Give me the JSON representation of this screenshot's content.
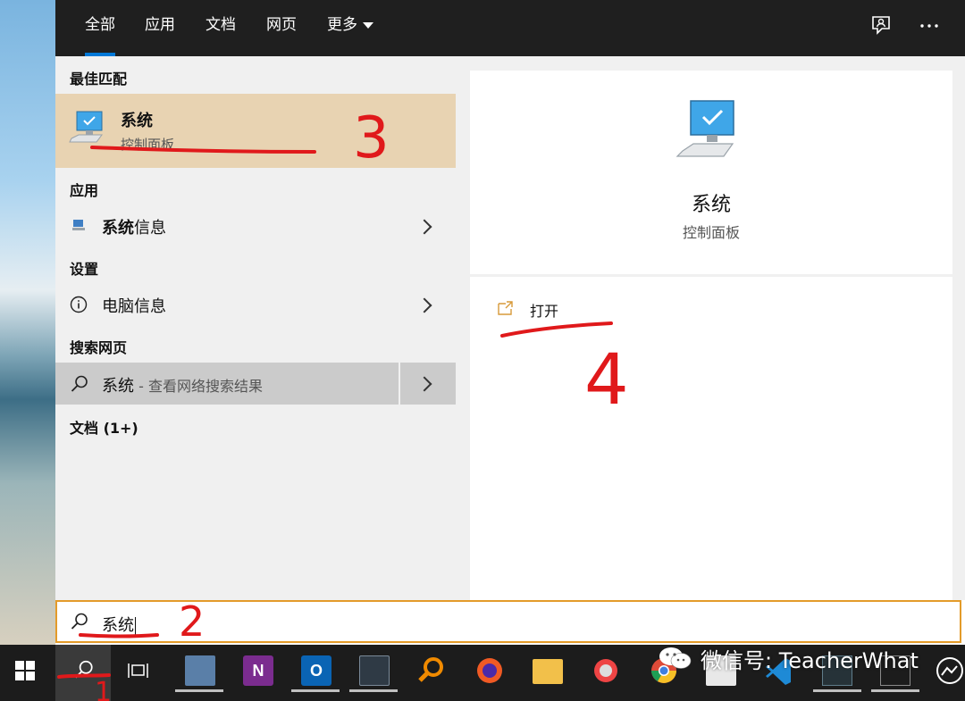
{
  "tabs": [
    {
      "label": "全部",
      "active": true
    },
    {
      "label": "应用",
      "active": false
    },
    {
      "label": "文档",
      "active": false
    },
    {
      "label": "网页",
      "active": false
    },
    {
      "label": "更多",
      "active": false
    }
  ],
  "left": {
    "best_match_header": "最佳匹配",
    "best_match": {
      "title": "系统",
      "subtitle": "控制面板"
    },
    "apps_header": "应用",
    "app_item": {
      "bold": "系统",
      "rest": "信息"
    },
    "settings_header": "设置",
    "settings_item": "电脑信息",
    "web_header": "搜索网页",
    "web_item": {
      "query": "系统",
      "suffix": " - 查看网络搜索结果"
    },
    "docs_header": "文档 (1+)"
  },
  "right": {
    "title": "系统",
    "subtitle": "控制面板",
    "action_open": "打开"
  },
  "search": {
    "value": "系统"
  },
  "watermark": "微信号: TeacherWhat",
  "annotations": [
    "1",
    "2",
    "3",
    "4"
  ],
  "colors": {
    "accent": "#0078d7",
    "search_border": "#e39b2a",
    "annotation": "#e0191b",
    "best_match_bg": "#e8d3b2"
  }
}
